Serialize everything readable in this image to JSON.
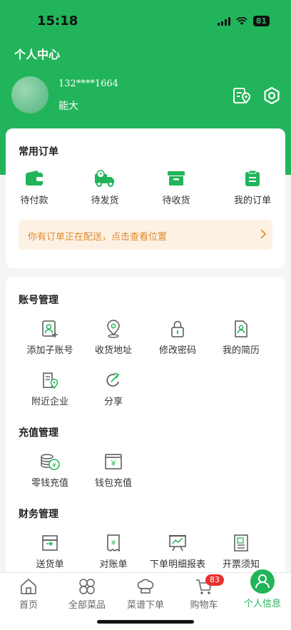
{
  "status_bar": {
    "time": "15:18",
    "battery": "81"
  },
  "header": {
    "title": "个人中心",
    "phone": "132****1664",
    "nickname": "能大"
  },
  "orders": {
    "title": "常用订单",
    "items": [
      {
        "label": "待付款",
        "icon": "wallet-icon"
      },
      {
        "label": "待发货",
        "icon": "truck-icon"
      },
      {
        "label": "待收货",
        "icon": "box-icon"
      },
      {
        "label": "我的订单",
        "icon": "clipboard-icon"
      }
    ],
    "notice": "你有订单正在配送，点击查看位置"
  },
  "account": {
    "title": "账号管理",
    "items": [
      "添加子账号",
      "收货地址",
      "修改密码",
      "我的简历",
      "附近企业",
      "分享"
    ]
  },
  "recharge": {
    "title": "充值管理",
    "items": [
      "零钱充值",
      "钱包充值"
    ]
  },
  "finance": {
    "title": "财务管理",
    "items": [
      "送货单",
      "对账单",
      "下单明细报表",
      "开票须知"
    ]
  },
  "tabbar": {
    "items": [
      "首页",
      "全部菜品",
      "菜谱下单",
      "购物车",
      "个人信息"
    ],
    "cart_badge": "83",
    "active": "个人信息"
  },
  "colors": {
    "brand": "#22b45a",
    "notice_bg": "#fdf1e4",
    "notice_text": "#e08a2e",
    "badge": "#e8322f"
  }
}
